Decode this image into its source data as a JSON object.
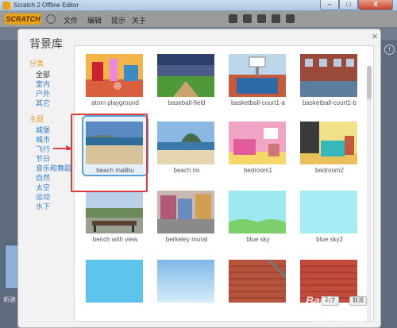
{
  "window": {
    "title": "Scratch 2 Offline Editor",
    "close_label": "X"
  },
  "menubar": {
    "logo": "SCRATCH",
    "items": [
      "文件",
      "编辑",
      "提示",
      "关于"
    ]
  },
  "dialog": {
    "title": "背景库",
    "close_label": "×",
    "categories": {
      "category_header": "分类",
      "category_items": [
        "全部",
        "室内",
        "户外",
        "其它"
      ],
      "theme_header": "主题",
      "theme_items": [
        "城堡",
        "城市",
        "飞行",
        "节日",
        "音乐和舞蹈",
        "自然",
        "太空",
        "运动",
        "水下"
      ]
    },
    "selected_category": "全部",
    "backdrops": [
      {
        "label": "atom playground",
        "icon": "playground-thumbnail"
      },
      {
        "label": "baseball-field",
        "icon": "stadium-thumbnail"
      },
      {
        "label": "basketball-court1-a",
        "icon": "court-thumbnail"
      },
      {
        "label": "basketball-court1-b",
        "icon": "court-brick-thumbnail"
      },
      {
        "label": "beach malibu",
        "icon": "beach-thumbnail"
      },
      {
        "label": "beach rio",
        "icon": "rio-thumbnail"
      },
      {
        "label": "bedroom1",
        "icon": "bedroom-pink-thumbnail"
      },
      {
        "label": "bedroom2",
        "icon": "bedroom-teal-thumbnail"
      },
      {
        "label": "bench with view",
        "icon": "bench-thumbnail"
      },
      {
        "label": "berkeley mural",
        "icon": "mural-thumbnail"
      },
      {
        "label": "blue sky",
        "icon": "sky-hills-thumbnail"
      },
      {
        "label": "blue sky2",
        "icon": "sky-thumbnail"
      },
      {
        "label": "",
        "icon": "sky-blue-thumbnail"
      },
      {
        "label": "",
        "icon": "sky-light-thumbnail"
      },
      {
        "label": "",
        "icon": "brick-wall-thumbnail"
      },
      {
        "label": "",
        "icon": "brick-red-thumbnail"
      }
    ],
    "selected_backdrop": "beach malibu",
    "ok_label": "确定",
    "cancel_label": "取消"
  },
  "editor": {
    "new_backdrop_label": "新建"
  },
  "watermark": {
    "brand": "Baidu",
    "url": "jingyan.baidu.com"
  },
  "colors": {
    "accent": "#e09a2a",
    "link": "#2f7fd0",
    "selection": "#5aa0d6",
    "annotation": "#e03a3a"
  }
}
